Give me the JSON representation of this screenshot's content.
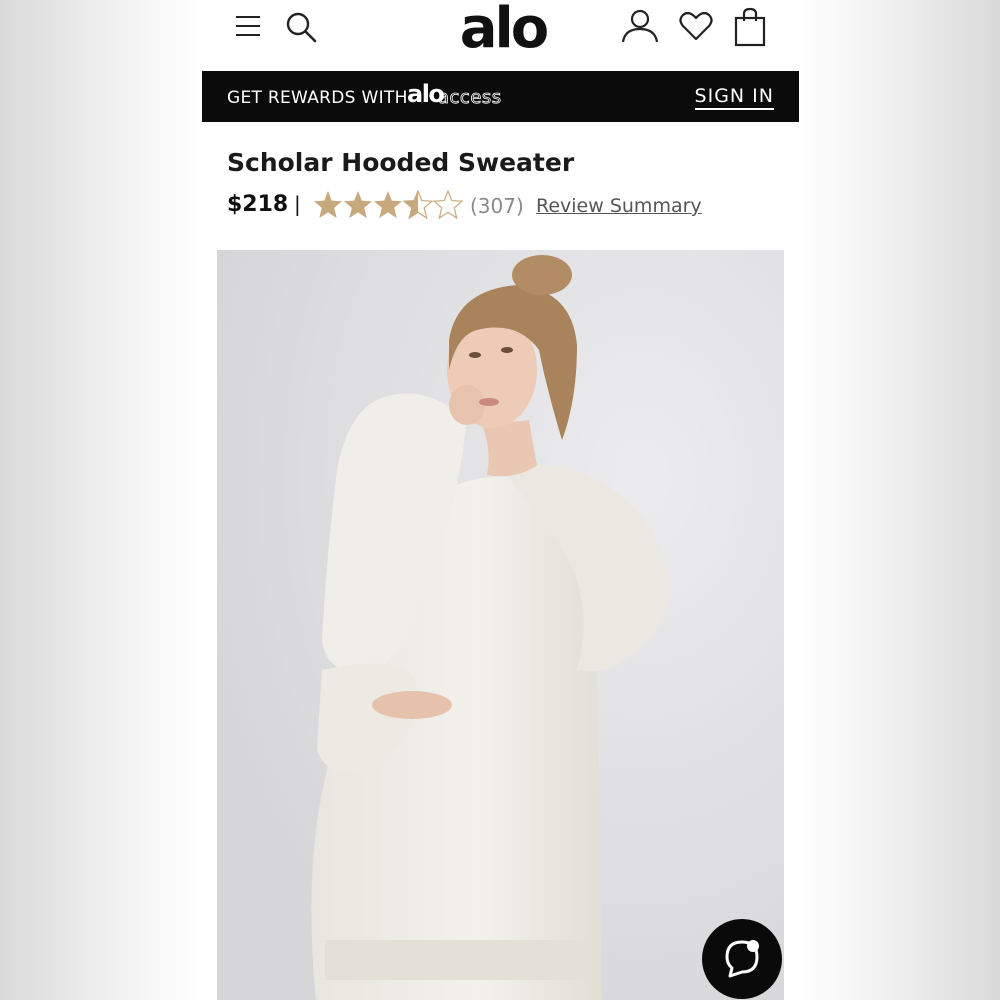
{
  "header": {
    "logo": "alo",
    "icons": [
      "menu-icon",
      "search-icon",
      "account-icon",
      "heart-icon",
      "bag-icon"
    ]
  },
  "banner": {
    "text": "GET REWARDS WITH",
    "brand_logo": "alo",
    "brand_suffix": "access",
    "signin_label": "SIGN IN"
  },
  "product": {
    "title": "Scholar Hooded Sweater",
    "price": "$218",
    "separator": "|",
    "rating": 3.5,
    "rating_max": 5,
    "review_count": "(307)",
    "review_link": "Review Summary",
    "image_alt": "model-wearing-cream-hooded-sweater"
  },
  "colors": {
    "star": "#c8a97e",
    "banner_bg": "#0b0b0b",
    "image_bg": "#e1e1e3"
  },
  "chat": {
    "icon": "chat-icon"
  }
}
